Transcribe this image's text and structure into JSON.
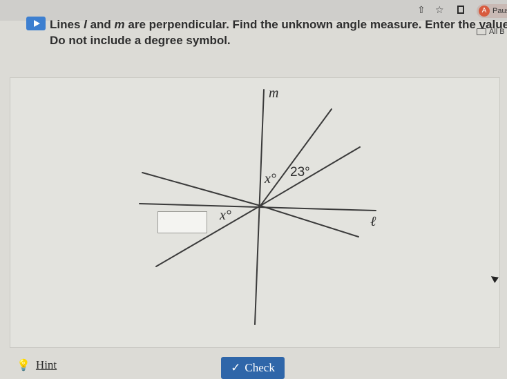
{
  "browser": {
    "profile_initial": "A",
    "profile_label": "Paus",
    "bookmarks_label": "All B",
    "icons": [
      "share-icon",
      "star-icon",
      "side-panel-icon"
    ]
  },
  "question": {
    "line1_prefix": "Lines ",
    "line1_var_l": "l",
    "line1_mid": " and ",
    "line1_var_m": "m",
    "line1_suffix": " are perpendicular. Find the unknown angle measure. Enter the value.",
    "line2": "Do not include a degree symbol."
  },
  "diagram": {
    "label_m": "m",
    "label_l": "ℓ",
    "angle_x_top": "x°",
    "angle_23": "23°",
    "angle_x_left": "x°"
  },
  "answer": {
    "value": ""
  },
  "footer": {
    "hint_label": "Hint",
    "check_label": "Check"
  },
  "colors": {
    "check_button": "#2f66a9",
    "play_button": "#3d7fd0"
  }
}
